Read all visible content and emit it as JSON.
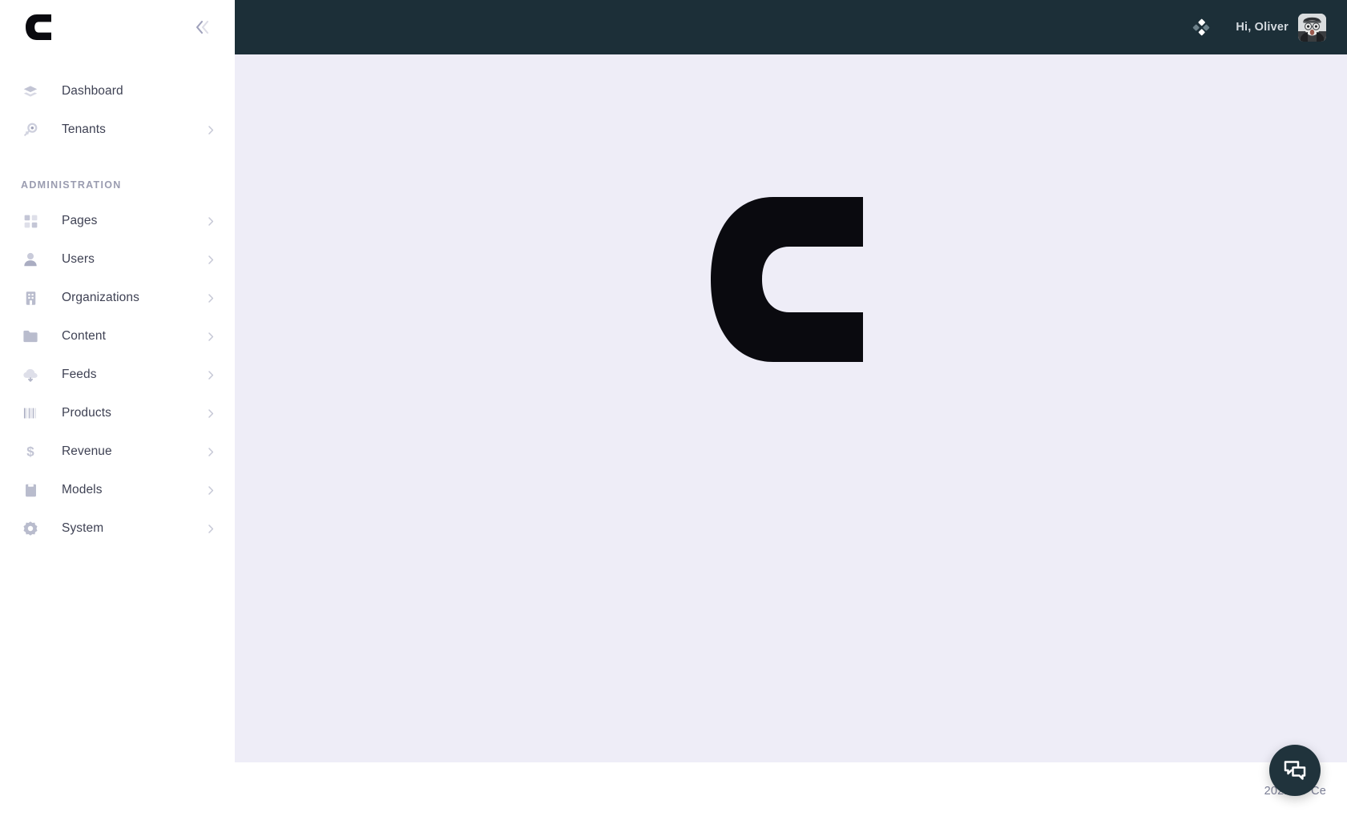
{
  "brand": {
    "logo_icon": "letter-c-logo",
    "mark_letter": "C"
  },
  "sidebar": {
    "collapse_icon": "double-chevron-left-icon",
    "primary_items": [
      {
        "label": "Dashboard",
        "icon": "layers-diamond-icon",
        "has_caret": false
      },
      {
        "label": "Tenants",
        "icon": "key-icon",
        "has_caret": true
      }
    ],
    "section_title": "ADMINISTRATION",
    "admin_items": [
      {
        "label": "Pages",
        "icon": "grid-squares-icon",
        "has_caret": true
      },
      {
        "label": "Users",
        "icon": "person-icon",
        "has_caret": true
      },
      {
        "label": "Organizations",
        "icon": "building-icon",
        "has_caret": true
      },
      {
        "label": "Content",
        "icon": "folder-icon",
        "has_caret": true
      },
      {
        "label": "Feeds",
        "icon": "cloud-download-icon",
        "has_caret": true
      },
      {
        "label": "Products",
        "icon": "barcode-icon",
        "has_caret": true
      },
      {
        "label": "Revenue",
        "icon": "dollar-sign-icon",
        "has_caret": true
      },
      {
        "label": "Models",
        "icon": "book-icon",
        "has_caret": true
      },
      {
        "label": "System",
        "icon": "gear-icon",
        "has_caret": true
      }
    ]
  },
  "topbar": {
    "grid_icon": "four-diamonds-icon",
    "greeting": "Hi, Oliver",
    "avatar_icon": "user-avatar-photo"
  },
  "content": {
    "logo_icon": "letter-c-logo-large"
  },
  "footer": {
    "year": "2022 ©",
    "brand": "Ce"
  },
  "chat": {
    "icon": "chat-bubbles-icon"
  },
  "colors": {
    "topbar_bg": "#1c2f38",
    "content_bg": "#eeedf7",
    "sidebar_bg": "#ffffff",
    "nav_label": "#3f4254",
    "nav_icon": "#b5b7c8",
    "section_title": "#9a9cb0",
    "footer_text": "#7e8299",
    "fab_bg": "#20333c",
    "logo_black": "#0a0a0f"
  }
}
